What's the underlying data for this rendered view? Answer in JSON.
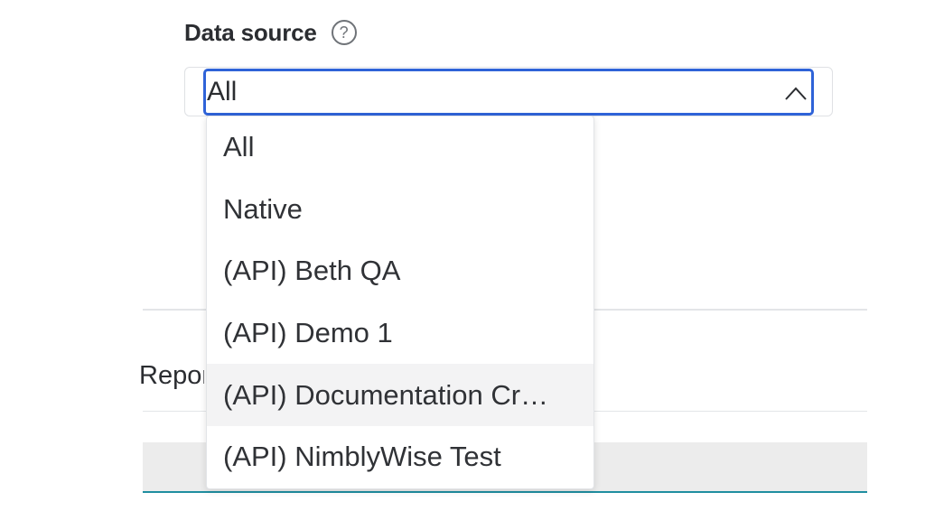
{
  "field": {
    "label": "Data source",
    "help_icon": "question-circle-icon"
  },
  "select": {
    "value": "All",
    "caret_icon": "chevron-up-icon"
  },
  "background": {
    "row_text": "Repor"
  },
  "dropdown": {
    "options": [
      {
        "label": "All"
      },
      {
        "label": "Native"
      },
      {
        "label": "(API) Beth QA"
      },
      {
        "label": "(API) Demo 1"
      },
      {
        "label": "(API) Documentation Cr…",
        "highlighted": true
      },
      {
        "label": "(API) NimblyWise Test"
      }
    ]
  },
  "colors": {
    "focus_border": "#2f63d8",
    "highlight_bg": "#f3f3f4",
    "teal_line": "#1f8ea0"
  }
}
